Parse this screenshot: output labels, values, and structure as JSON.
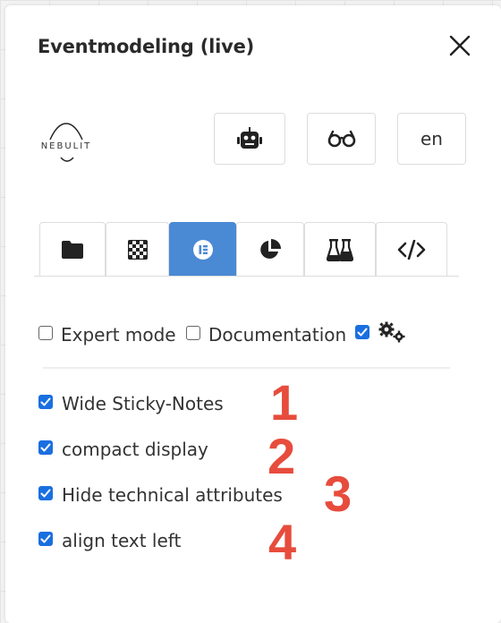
{
  "dialog": {
    "title": "Eventmodeling (live)",
    "logo_text": "NEBULIT"
  },
  "toolbar": {
    "buttons": [
      {
        "icon": "robot-icon"
      },
      {
        "icon": "glasses-icon"
      },
      {
        "label": "en"
      }
    ]
  },
  "tabs": [
    {
      "icon": "folder-icon",
      "active": false
    },
    {
      "icon": "checkerboard-icon",
      "active": false
    },
    {
      "icon": "elementor-icon",
      "active": true
    },
    {
      "icon": "pie-chart-icon",
      "active": false
    },
    {
      "icon": "flask-icon",
      "active": false
    },
    {
      "icon": "code-icon",
      "active": false
    }
  ],
  "modes": {
    "expert_label": "Expert mode",
    "expert_checked": false,
    "documentation_label": "Documentation",
    "documentation_checked": false,
    "settings_checked": true,
    "settings_icon": "cogs-icon"
  },
  "options": [
    {
      "label": "Wide Sticky-Notes",
      "checked": true,
      "annotation": "1"
    },
    {
      "label": "compact display",
      "checked": true,
      "annotation": "2"
    },
    {
      "label": "Hide technical attributes",
      "checked": true,
      "annotation": "3"
    },
    {
      "label": "align text left",
      "checked": true,
      "annotation": "4"
    }
  ],
  "colors": {
    "accent": "#4a89d4",
    "checkbox": "#1a6fe0",
    "annotation": "#e74c3c"
  }
}
